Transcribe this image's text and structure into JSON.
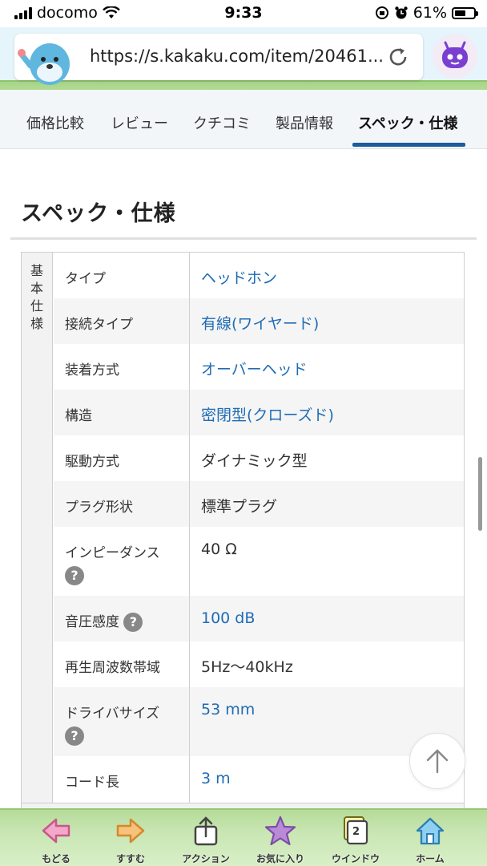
{
  "status_bar": {
    "carrier": "docomo",
    "time": "9:33",
    "battery": "61%",
    "battery_level": 0.61
  },
  "browser": {
    "url": "https://s.kakaku.com/item/20461..."
  },
  "tabs": [
    {
      "label": "価格比較"
    },
    {
      "label": "レビュー"
    },
    {
      "label": "クチコミ"
    },
    {
      "label": "製品情報"
    },
    {
      "label": "スペック・仕様",
      "active": true
    }
  ],
  "section": {
    "title": "スペック・仕様"
  },
  "spec": {
    "group": "基本仕様",
    "help_icon": "?",
    "rows": [
      {
        "key": "タイプ",
        "value": "ヘッドホン"
      },
      {
        "key": "接続タイプ",
        "value": "有線(ワイヤード)"
      },
      {
        "key": "装着方式",
        "value": "オーバーヘッド"
      },
      {
        "key": "構造",
        "value": "密閉型(クローズド)"
      },
      {
        "key": "駆動方式",
        "value": "ダイナミック型"
      },
      {
        "key": "プラグ形状",
        "value": "標準プラグ"
      },
      {
        "key": "インピーダンス",
        "value": "40 Ω"
      },
      {
        "key": "音圧感度",
        "value": "100 dB"
      },
      {
        "key": "再生周波数帯域",
        "value": "5Hz〜40kHz"
      },
      {
        "key": "ドライバサイズ",
        "value": "53 mm"
      },
      {
        "key": "コード長",
        "value": "3 m"
      }
    ]
  },
  "toolbar": {
    "back": "もどる",
    "forward": "すすむ",
    "action": "アクション",
    "favorites": "お気に入り",
    "windows": "ウインドウ",
    "window_count": "2",
    "home": "ホーム"
  }
}
